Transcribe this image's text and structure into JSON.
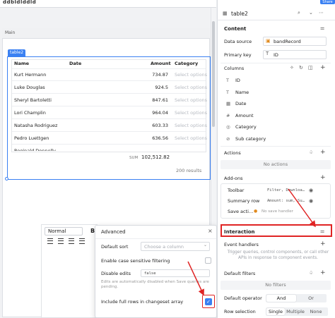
{
  "app": {
    "title": "ddbldlddld"
  },
  "canvas": {
    "frame_label": "Main",
    "table_tag": "table2",
    "table": {
      "columns": [
        "Name",
        "Date",
        "Amount",
        "Category"
      ],
      "rows": [
        {
          "name": "Kurt Hermann",
          "amount": "734.87",
          "category": "Select options"
        },
        {
          "name": "Luke Douglas",
          "amount": "924.5",
          "category": "Select options"
        },
        {
          "name": "Sheryl Bartoletti",
          "amount": "847.61",
          "category": "Select options"
        },
        {
          "name": "Lori Champlin",
          "amount": "964.04",
          "category": "Select options"
        },
        {
          "name": "Natasha Rodriguez",
          "amount": "603.33",
          "category": "Select options"
        },
        {
          "name": "Pedro Luettgen",
          "amount": "636.56",
          "category": "Select options"
        },
        {
          "name": "Reginald Donnelly",
          "amount": "",
          "category": ""
        }
      ],
      "sum_label": "SUM",
      "sum_value": "102,512.82",
      "results": "200 results"
    },
    "editor": {
      "format": "Normal",
      "bold": "B"
    }
  },
  "advanced": {
    "title": "Advanced",
    "close": "×",
    "default_sort_label": "Default sort",
    "default_sort_placeholder": "Choose a column",
    "case_sensitive_label": "Enable case sensitive filtering",
    "disable_edits_label": "Disable edits",
    "disable_edits_value": "false",
    "note": "Edits are automatically disabled when Save queries are pending.",
    "full_rows_label": "Include full rows in changeset array",
    "full_rows_checked": true
  },
  "inspector": {
    "component_name": "table2",
    "share": "Share",
    "content_title": "Content",
    "data_source_label": "Data source",
    "data_source_value": "bandRecord",
    "primary_key_label": "Primary key",
    "primary_key_value": "ID",
    "columns_label": "Columns",
    "columns": [
      {
        "icon": "T",
        "name": "ID"
      },
      {
        "icon": "T",
        "name": "Name"
      },
      {
        "icon": "▦",
        "name": "Date"
      },
      {
        "icon": "#",
        "name": "Amount"
      },
      {
        "icon": "◎",
        "name": "Category"
      },
      {
        "icon": "⊘",
        "name": "Sub category"
      }
    ],
    "actions_label": "Actions",
    "no_actions": "No actions",
    "addons_label": "Add-ons",
    "addons": [
      {
        "label": "Toolbar",
        "value": "Filter, Downloa…"
      },
      {
        "label": "Summary row",
        "value": "Amount: sum, Su…"
      },
      {
        "label": "Save acti…",
        "value": "No save handler"
      }
    ],
    "interaction_title": "Interaction",
    "event_handlers_label": "Event handlers",
    "event_handlers_note": "Trigger queries, control components, or call other APIs in response to component events.",
    "default_filters_label": "Default filters",
    "no_filters": "No filters",
    "default_operator_label": "Default operator",
    "operator_and": "And",
    "operator_or": "Or",
    "row_selection_label": "Row selection",
    "row_single": "Single",
    "row_multiple": "Multiple",
    "row_none": "None"
  },
  "colors": {
    "accent": "#3a80f2",
    "highlight": "#e02424"
  }
}
